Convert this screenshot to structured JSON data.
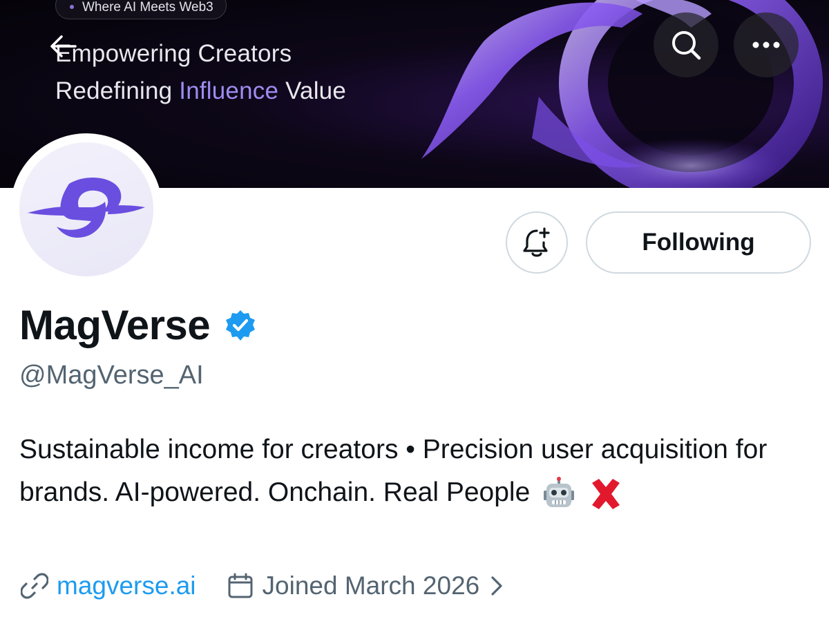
{
  "banner": {
    "pill_text": "Where AI Meets Web3",
    "tagline_line1": "Empowering Creators",
    "tagline_line2_pre": "Redefining",
    "tagline_line2_highlight": "Influence",
    "tagline_line2_post": "Value",
    "highlight_color": "#9f8cf0"
  },
  "nav": {
    "back_icon": "arrow-left-icon",
    "search_icon": "search-icon",
    "more_icon": "more-horizontal-icon"
  },
  "actions": {
    "notify_icon": "bell-plus-icon",
    "following_label": "Following"
  },
  "profile": {
    "name": "MagVerse",
    "verified_icon": "verified-badge-icon",
    "verified_color": "#1d9bf0",
    "handle": "@MagVerse_AI",
    "bio": "Sustainable income for creators • Precision user acquisition for brands. AI-powered. Onchain. Real People",
    "bio_emojis": [
      "robot-emoji",
      "cross-mark-emoji"
    ],
    "website": "magverse.ai",
    "website_icon": "link-icon",
    "joined": "Joined March 2026",
    "joined_icon": "calendar-icon",
    "brand_color": "#6a4ee0"
  }
}
